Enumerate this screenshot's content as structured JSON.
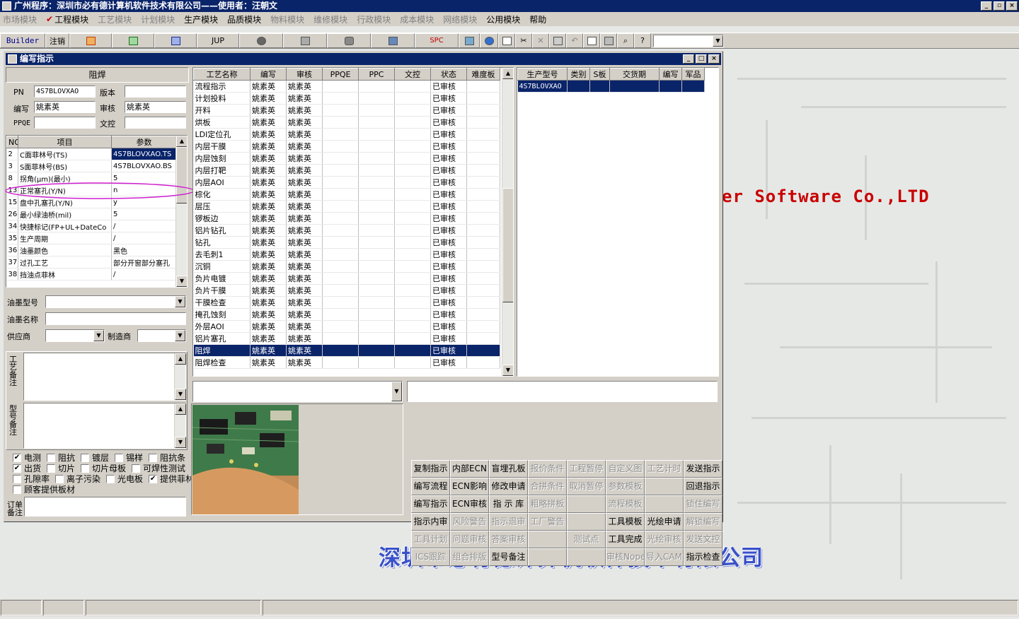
{
  "app": {
    "title": "广州程序：深圳市必有德计算机软件技术有限公司——使用者：汪朝文",
    "window_buttons": [
      "_",
      "▫",
      "×"
    ]
  },
  "menu": [
    {
      "label": "市场模块",
      "enabled": false
    },
    {
      "label": "工程模块",
      "enabled": true,
      "checked": true
    },
    {
      "label": "工艺模块",
      "enabled": false
    },
    {
      "label": "计划模块",
      "enabled": false
    },
    {
      "label": "生产模块",
      "enabled": true
    },
    {
      "label": "品质模块",
      "enabled": true
    },
    {
      "label": "物料模块",
      "enabled": false
    },
    {
      "label": "维修模块",
      "enabled": false
    },
    {
      "label": "行政模块",
      "enabled": false
    },
    {
      "label": "成本模块",
      "enabled": false
    },
    {
      "label": "网络模块",
      "enabled": false
    },
    {
      "label": "公用模块",
      "enabled": true
    },
    {
      "label": "帮助",
      "enabled": true
    }
  ],
  "toolbar": {
    "builder": "Builder",
    "logout": "注销",
    "jup": "JUP",
    "spc": "SPC"
  },
  "background": {
    "watermark": "er Software Co.,LTD",
    "company": "深圳市必有德计算机软件技术有限公司"
  },
  "window": {
    "title": "编写指示",
    "buttons": [
      "_",
      "□",
      "×"
    ]
  },
  "left": {
    "header": "阻焊",
    "pn_label": "PN",
    "pn_value": "4S7BLOVXAO",
    "version_label": "版本",
    "version_value": "",
    "editor_label": "编写",
    "editor_value": "姚素英",
    "review_label": "审核",
    "review_value": "姚素英",
    "ppqe_label": "PPQE",
    "ppqe_value": "",
    "dcc_label": "文控",
    "dcc_value": "",
    "param_table": {
      "headers": [
        "NO",
        "项目",
        "参数"
      ],
      "rows": [
        [
          "2",
          "C面菲林号(TS)",
          "4S7BLOVXAO.TS"
        ],
        [
          "3",
          "S面菲林号(BS)",
          "4S7BLOVXAO.BS"
        ],
        [
          "8",
          "拐角(μm)(最小)",
          "5"
        ],
        [
          "13",
          "正常塞孔(Y/N)",
          "n"
        ],
        [
          "15",
          "盘中孔塞孔(Y/N)",
          "y"
        ],
        [
          "26",
          "最小绿油桥(mil)",
          "5"
        ],
        [
          "34",
          "快捷标记(FP+UL+DateCo",
          "/"
        ],
        [
          "35",
          "生产周期",
          "/"
        ],
        [
          "36",
          "油墨颜色",
          "黑色"
        ],
        [
          "37",
          "过孔工艺",
          "部分开窗部分塞孔"
        ],
        [
          "38",
          "挡油点菲林",
          "/"
        ]
      ]
    },
    "ink_model_label": "油墨型号",
    "ink_name_label": "油墨名称",
    "supplier_label": "供应商",
    "manufacturer_label": "制造商",
    "process_note_label": "工艺备注",
    "model_note_label": "型号备注",
    "order_note_label": "订单备注",
    "checkboxes": [
      [
        {
          "label": "电测",
          "checked": true
        },
        {
          "label": "阻抗",
          "checked": false
        },
        {
          "label": "镀层",
          "checked": false
        },
        {
          "label": "锡样",
          "checked": false
        },
        {
          "label": "阻抗条",
          "checked": false
        }
      ],
      [
        {
          "label": "出货",
          "checked": true
        },
        {
          "label": "切片",
          "checked": false
        },
        {
          "label": "切片母板",
          "checked": false
        },
        {
          "label": "可焊性测试",
          "checked": false
        }
      ],
      [
        {
          "label": "孔隙率",
          "checked": false
        },
        {
          "label": "离子污染",
          "checked": false
        },
        {
          "label": "光电板",
          "checked": false
        },
        {
          "label": "提供菲林",
          "checked": true
        }
      ],
      [
        {
          "label": "顾客提供板材",
          "checked": false
        }
      ]
    ]
  },
  "process_table": {
    "headers": [
      "工艺名称",
      "编写",
      "审核",
      "PPQE",
      "PPC",
      "文控",
      "状态",
      "难度板"
    ],
    "selected_index": 22,
    "rows": [
      [
        "流程指示",
        "姚素英",
        "姚素英",
        "",
        "",
        "",
        "已审核",
        ""
      ],
      [
        "计划投料",
        "姚素英",
        "姚素英",
        "",
        "",
        "",
        "已审核",
        ""
      ],
      [
        "开料",
        "姚素英",
        "姚素英",
        "",
        "",
        "",
        "已审核",
        ""
      ],
      [
        "烘板",
        "姚素英",
        "姚素英",
        "",
        "",
        "",
        "已审核",
        ""
      ],
      [
        "LDI定位孔",
        "姚素英",
        "姚素英",
        "",
        "",
        "",
        "已审核",
        ""
      ],
      [
        "内层干膜",
        "姚素英",
        "姚素英",
        "",
        "",
        "",
        "已审核",
        ""
      ],
      [
        "内层蚀刻",
        "姚素英",
        "姚素英",
        "",
        "",
        "",
        "已审核",
        ""
      ],
      [
        "内层打靶",
        "姚素英",
        "姚素英",
        "",
        "",
        "",
        "已审核",
        ""
      ],
      [
        "内层AOI",
        "姚素英",
        "姚素英",
        "",
        "",
        "",
        "已审核",
        ""
      ],
      [
        "棕化",
        "姚素英",
        "姚素英",
        "",
        "",
        "",
        "已审核",
        ""
      ],
      [
        "层压",
        "姚素英",
        "姚素英",
        "",
        "",
        "",
        "已审核",
        ""
      ],
      [
        "锣板边",
        "姚素英",
        "姚素英",
        "",
        "",
        "",
        "已审核",
        ""
      ],
      [
        "铝片钻孔",
        "姚素英",
        "姚素英",
        "",
        "",
        "",
        "已审核",
        ""
      ],
      [
        "钻孔",
        "姚素英",
        "姚素英",
        "",
        "",
        "",
        "已审核",
        ""
      ],
      [
        "去毛刺1",
        "姚素英",
        "姚素英",
        "",
        "",
        "",
        "已审核",
        ""
      ],
      [
        "沉铜",
        "姚素英",
        "姚素英",
        "",
        "",
        "",
        "已审核",
        ""
      ],
      [
        "负片电镀",
        "姚素英",
        "姚素英",
        "",
        "",
        "",
        "已审核",
        ""
      ],
      [
        "负片干膜",
        "姚素英",
        "姚素英",
        "",
        "",
        "",
        "已审核",
        ""
      ],
      [
        "干膜检查",
        "姚素英",
        "姚素英",
        "",
        "",
        "",
        "已审核",
        ""
      ],
      [
        "掩孔蚀刻",
        "姚素英",
        "姚素英",
        "",
        "",
        "",
        "已审核",
        ""
      ],
      [
        "外层AOI",
        "姚素英",
        "姚素英",
        "",
        "",
        "",
        "已审核",
        ""
      ],
      [
        "铝片塞孔",
        "姚素英",
        "姚素英",
        "",
        "",
        "",
        "已审核",
        ""
      ],
      [
        "阻焊",
        "姚素英",
        "姚素英",
        "",
        "",
        "",
        "已审核",
        ""
      ],
      [
        "阻焊检查",
        "姚素英",
        "姚素英",
        "",
        "",
        "",
        "已审核",
        ""
      ]
    ]
  },
  "model_table": {
    "headers": [
      "生产型号",
      "类别",
      "S板",
      "交货期",
      "编写",
      "军品"
    ],
    "rows": [
      [
        "4S7BLOVXAO",
        "",
        "",
        "",
        "",
        ""
      ]
    ]
  },
  "actions": [
    {
      "label": "复制指示",
      "enabled": true
    },
    {
      "label": "内部ECN",
      "enabled": true
    },
    {
      "label": "盲埋孔板",
      "enabled": true
    },
    {
      "label": "报价条件",
      "enabled": false
    },
    {
      "label": "工程暂停",
      "enabled": false
    },
    {
      "label": "自定义图",
      "enabled": false
    },
    {
      "label": "工艺计时",
      "enabled": false
    },
    {
      "label": "发送指示",
      "enabled": true
    },
    {
      "label": "编写流程",
      "enabled": true
    },
    {
      "label": "ECN影响",
      "enabled": true
    },
    {
      "label": "修改申请",
      "enabled": true
    },
    {
      "label": "合拼条件",
      "enabled": false
    },
    {
      "label": "取消暂停",
      "enabled": false
    },
    {
      "label": "参数模板",
      "enabled": false
    },
    {
      "label": "",
      "enabled": false
    },
    {
      "label": "回退指示",
      "enabled": true
    },
    {
      "label": "编写指示",
      "enabled": true
    },
    {
      "label": "ECN审核",
      "enabled": true
    },
    {
      "label": "指 示 库",
      "enabled": true
    },
    {
      "label": "粗略拼板",
      "enabled": false
    },
    {
      "label": "",
      "enabled": false
    },
    {
      "label": "流程模板",
      "enabled": false
    },
    {
      "label": "",
      "enabled": false
    },
    {
      "label": "锁住编写",
      "enabled": false
    },
    {
      "label": "指示内审",
      "enabled": true
    },
    {
      "label": "风险警告",
      "enabled": false
    },
    {
      "label": "指示退审",
      "enabled": false
    },
    {
      "label": "工厂警告",
      "enabled": false
    },
    {
      "label": "",
      "enabled": false
    },
    {
      "label": "工具模板",
      "enabled": true
    },
    {
      "label": "光绘申请",
      "enabled": true
    },
    {
      "label": "解锁编写",
      "enabled": false
    },
    {
      "label": "工具计划",
      "enabled": false
    },
    {
      "label": "问题审核",
      "enabled": false
    },
    {
      "label": "答案审核",
      "enabled": false
    },
    {
      "label": "",
      "enabled": false
    },
    {
      "label": "测试点",
      "enabled": false
    },
    {
      "label": "工具完成",
      "enabled": true
    },
    {
      "label": "光绘审核",
      "enabled": false
    },
    {
      "label": "发送文控",
      "enabled": false
    },
    {
      "label": "ICS跟踪",
      "enabled": false
    },
    {
      "label": "组合排版",
      "enabled": false
    },
    {
      "label": "型号备注",
      "enabled": true
    },
    {
      "label": "",
      "enabled": false
    },
    {
      "label": "",
      "enabled": false
    },
    {
      "label": "审核Nope",
      "enabled": false
    },
    {
      "label": "导入CAM",
      "enabled": false
    },
    {
      "label": "指示检查",
      "enabled": true
    }
  ]
}
